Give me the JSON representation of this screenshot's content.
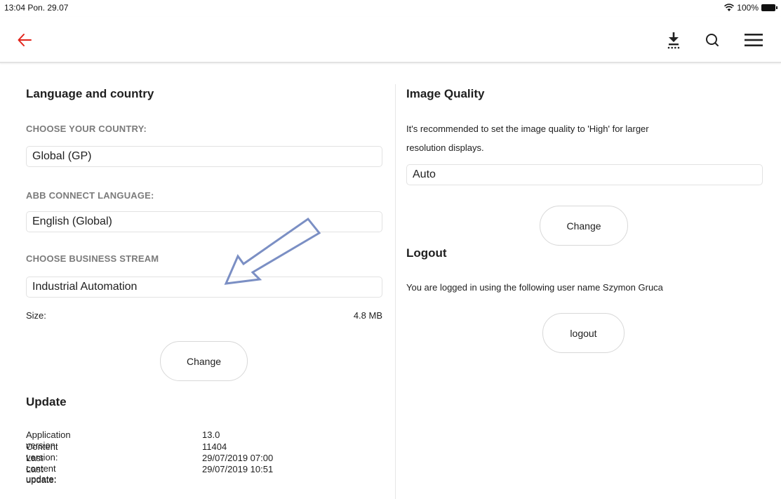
{
  "status_bar": {
    "time_date": "13:04  Pon. 29.07",
    "battery": "100%"
  },
  "nav": {
    "icons": [
      "back-arrow-icon",
      "download-icon",
      "search-icon",
      "menu-icon"
    ],
    "accent_color": "#e2231a"
  },
  "language_country": {
    "title": "Language and country",
    "country_label": "CHOOSE YOUR COUNTRY:",
    "country_value": "Global (GP)",
    "language_label": "ABB CONNECT LANGUAGE:",
    "language_value": "English (Global)",
    "business_label": "CHOOSE BUSINESS STREAM",
    "business_value": "Industrial Automation",
    "size_label": "Size:",
    "size_value": "4.8 MB",
    "change_button": "Change"
  },
  "update": {
    "title": "Update",
    "rows": [
      {
        "label": "Application version:",
        "value": "13.0"
      },
      {
        "label": "Content version:",
        "value": "11404"
      },
      {
        "label": "Last content update:",
        "value": "29/07/2019 07:00"
      },
      {
        "label": "Last update:",
        "value": "29/07/2019 10:51"
      }
    ]
  },
  "image_quality": {
    "title": "Image Quality",
    "description_line1": "It's recommended to set the image quality to 'High' for larger",
    "description_line2": "resolution displays.",
    "value": "Auto",
    "change_button": "Change"
  },
  "logout": {
    "title": "Logout",
    "description": "You are logged in using the following user name Szymon Gruca",
    "button": "logout"
  },
  "annotation": {
    "arrow_color": "#7b8fc4"
  }
}
